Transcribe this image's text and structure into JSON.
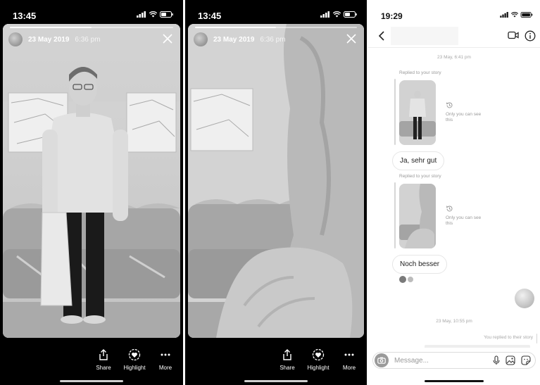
{
  "left_story": {
    "status_time": "13:45",
    "date": "23 May 2019",
    "time": "6:36 pm",
    "progress": 0.5,
    "actions": [
      {
        "icon": "share-icon",
        "label": "Share"
      },
      {
        "icon": "highlight-icon",
        "label": "Highlight"
      },
      {
        "icon": "more-icon",
        "label": "More"
      }
    ]
  },
  "middle_story": {
    "status_time": "13:45",
    "date": "23 May 2019",
    "time": "6:36 pm",
    "progress": 0.5,
    "actions": [
      {
        "icon": "share-icon",
        "label": "Share"
      },
      {
        "icon": "highlight-icon",
        "label": "Highlight"
      },
      {
        "icon": "more-icon",
        "label": "More"
      }
    ]
  },
  "chat": {
    "status_time": "19:29",
    "timestamp_1": "23 May, 6:41 pm",
    "replied_1": "Replied to your story",
    "only_you_1": "Only you can see this",
    "message_1": "Ja, sehr gut",
    "replied_2": "Replied to your story",
    "only_you_2": "Only you can see this",
    "message_2": "Noch besser",
    "timestamp_2": "23 May, 10:55 pm",
    "you_replied": "You replied to their story",
    "compose_placeholder": "Message..."
  },
  "colors": {
    "story_bg": "#000000",
    "chat_bg": "#ffffff",
    "muted_text": "#9a9a9a"
  }
}
